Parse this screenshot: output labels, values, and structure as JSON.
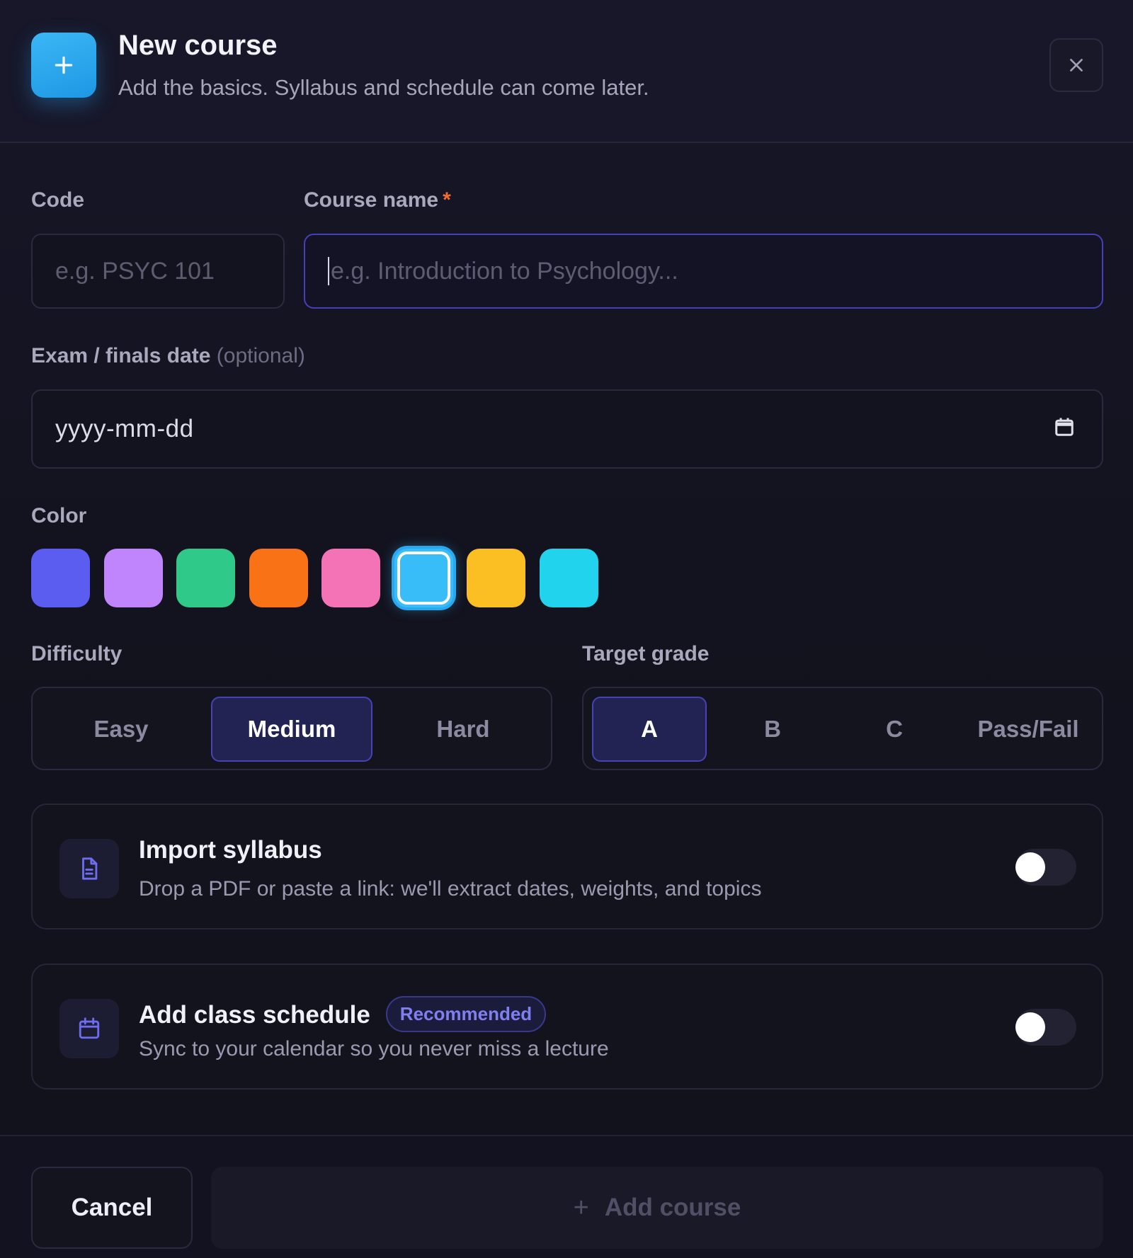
{
  "header": {
    "title": "New course",
    "subtitle": "Add the basics. Syllabus and schedule can come later.",
    "icon": "plus-icon",
    "close_icon": "close-icon"
  },
  "form": {
    "code": {
      "label": "Code",
      "placeholder": "e.g. PSYC 101",
      "value": ""
    },
    "course_name": {
      "label": "Course name",
      "required_mark": "*",
      "placeholder": "e.g. Introduction to Psychology...",
      "value": ""
    },
    "exam_date": {
      "label": "Exam / finals date",
      "optional_text": "(optional)",
      "value": "yyyy-mm-dd",
      "icon": "calendar-icon"
    },
    "color": {
      "label": "Color",
      "swatches": [
        "#5b5cf0",
        "#c084fc",
        "#2fc98a",
        "#f97316",
        "#f472b6",
        "#38bdf8",
        "#fbbf24",
        "#22d3ee"
      ],
      "selected": "#38bdf8"
    },
    "difficulty": {
      "label": "Difficulty",
      "options": [
        "Easy",
        "Medium",
        "Hard"
      ],
      "selected": "Medium"
    },
    "target_grade": {
      "label": "Target grade",
      "options": [
        "A",
        "B",
        "C",
        "Pass/Fail"
      ],
      "selected": "A"
    }
  },
  "options": {
    "import_syllabus": {
      "title": "Import syllabus",
      "description": "Drop a PDF or paste a link: we'll extract dates, weights, and topics",
      "icon": "document-icon",
      "enabled": false
    },
    "class_schedule": {
      "title": "Add class schedule",
      "badge": "Recommended",
      "description": "Sync to your calendar so you never miss a lecture",
      "icon": "calendar-icon",
      "enabled": false
    }
  },
  "footer": {
    "cancel_label": "Cancel",
    "submit_label": "Add course",
    "submit_icon": "plus-icon"
  },
  "colors": {
    "accent": "#4742b5",
    "background": "#12121f",
    "brand_icon": "#2aa8ef",
    "required_star": "#f06d2f",
    "badge_text": "#7f7ff0"
  }
}
